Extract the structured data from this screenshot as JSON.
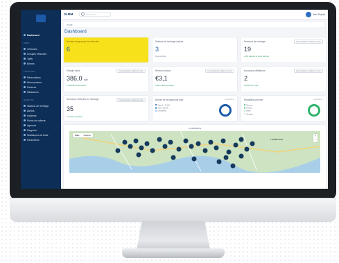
{
  "app": {
    "brand": "SLMM",
    "user": "Jean Dupont"
  },
  "search": {
    "placeholder": "Rechercher..."
  },
  "sidebar": {
    "dashboard": "Dashboard",
    "sections": [
      {
        "head": "PARC",
        "items": [
          "Véhicules",
          "Groupes véhicules",
          "Tarifs",
          "Bornes"
        ]
      },
      {
        "head": "LOCATION",
        "items": [
          "Réservations",
          "Abonnements",
          "Factures",
          "Utilisateurs"
        ]
      },
      {
        "head": "GESTION",
        "items": [
          "Stations de recharge",
          "Alertes",
          "Incidents",
          "Points de collecte",
          "Agences",
          "Rapports",
          "Statistiques de flotte",
          "Paramètres"
        ]
      }
    ]
  },
  "breadcrumb": "Home",
  "page_title": "Dashboard",
  "cards": {
    "yellow": {
      "label": "Nombre de groupes de véhicules",
      "value": "6"
    },
    "stations": {
      "label": "Stations de recharge actives",
      "value": "3",
      "sub": "Disponibles"
    },
    "sessions": {
      "label": "Sessions de recharge",
      "value": "19",
      "select": "Cumul depuis le début du mois",
      "sub": "+8% depuis le mois dernier"
    },
    "energy": {
      "label": "Énergie totale",
      "value": "386,0",
      "unit": "kWh",
      "select": "Cumul depuis le début du mois",
      "sub": "+3,8 kWh la semaine"
    },
    "revenue": {
      "label": "Revenus totaux",
      "value": "€3,1",
      "select": "Cumul depuis le début du mois",
      "sub": "+€0,4 cette semaine"
    },
    "alerts": {
      "label": "Nouveaux utilisateurs",
      "value": "2",
      "select": "Cumul depuis le début du mois",
      "sub": "+100% ce mois"
    },
    "vehicles": {
      "label": "Nouveaux véhicules en recharge",
      "value": "35",
      "select": "Cumul depuis le début du mois",
      "sub": "+5 cette semaine"
    },
    "donut1": {
      "label": "Bornes de recharge par type",
      "tag": "Aujourd'hui",
      "legend": [
        "Type 2 - 22 kW",
        "CCS - 50 kW",
        "CHAdeMO"
      ],
      "colors": [
        "#1c5aa8",
        "#46a3e0",
        "#9ec7ee"
      ]
    },
    "donut2": {
      "label": "Répartition par ville",
      "tag": "Aujourd'hui",
      "legend": [
        "Rennes",
        "Nantes",
        "Brest",
        "Quimper"
      ],
      "colors": [
        "#2fb36b",
        "#7fd3a4",
        "#b9e7cc",
        "#e2f4ea"
      ]
    }
  },
  "map": {
    "title": "Localisations",
    "btn_map": "Plan",
    "btn_sat": "Satellite",
    "city": "Landerneau",
    "zoom_in": "+",
    "zoom_out": "−"
  }
}
